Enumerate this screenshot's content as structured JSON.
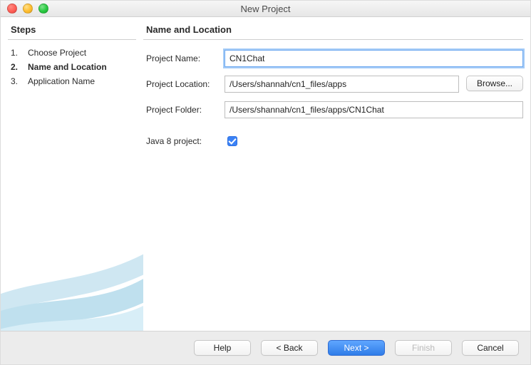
{
  "window": {
    "title": "New Project"
  },
  "sidebar": {
    "heading": "Steps",
    "steps": [
      {
        "num": "1.",
        "label": "Choose Project"
      },
      {
        "num": "2.",
        "label": "Name and Location"
      },
      {
        "num": "3.",
        "label": "Application Name"
      }
    ],
    "currentIndex": 1
  },
  "main": {
    "heading": "Name and Location",
    "fields": {
      "projectNameLabel": "Project Name:",
      "projectNameValue": "CN1Chat",
      "projectLocationLabel": "Project Location:",
      "projectLocationValue": "/Users/shannah/cn1_files/apps",
      "browseLabel": "Browse...",
      "projectFolderLabel": "Project Folder:",
      "projectFolderValue": "/Users/shannah/cn1_files/apps/CN1Chat",
      "java8Label": "Java 8 project:",
      "java8Checked": true
    }
  },
  "footer": {
    "help": "Help",
    "back": "< Back",
    "next": "Next >",
    "finish": "Finish",
    "cancel": "Cancel"
  }
}
